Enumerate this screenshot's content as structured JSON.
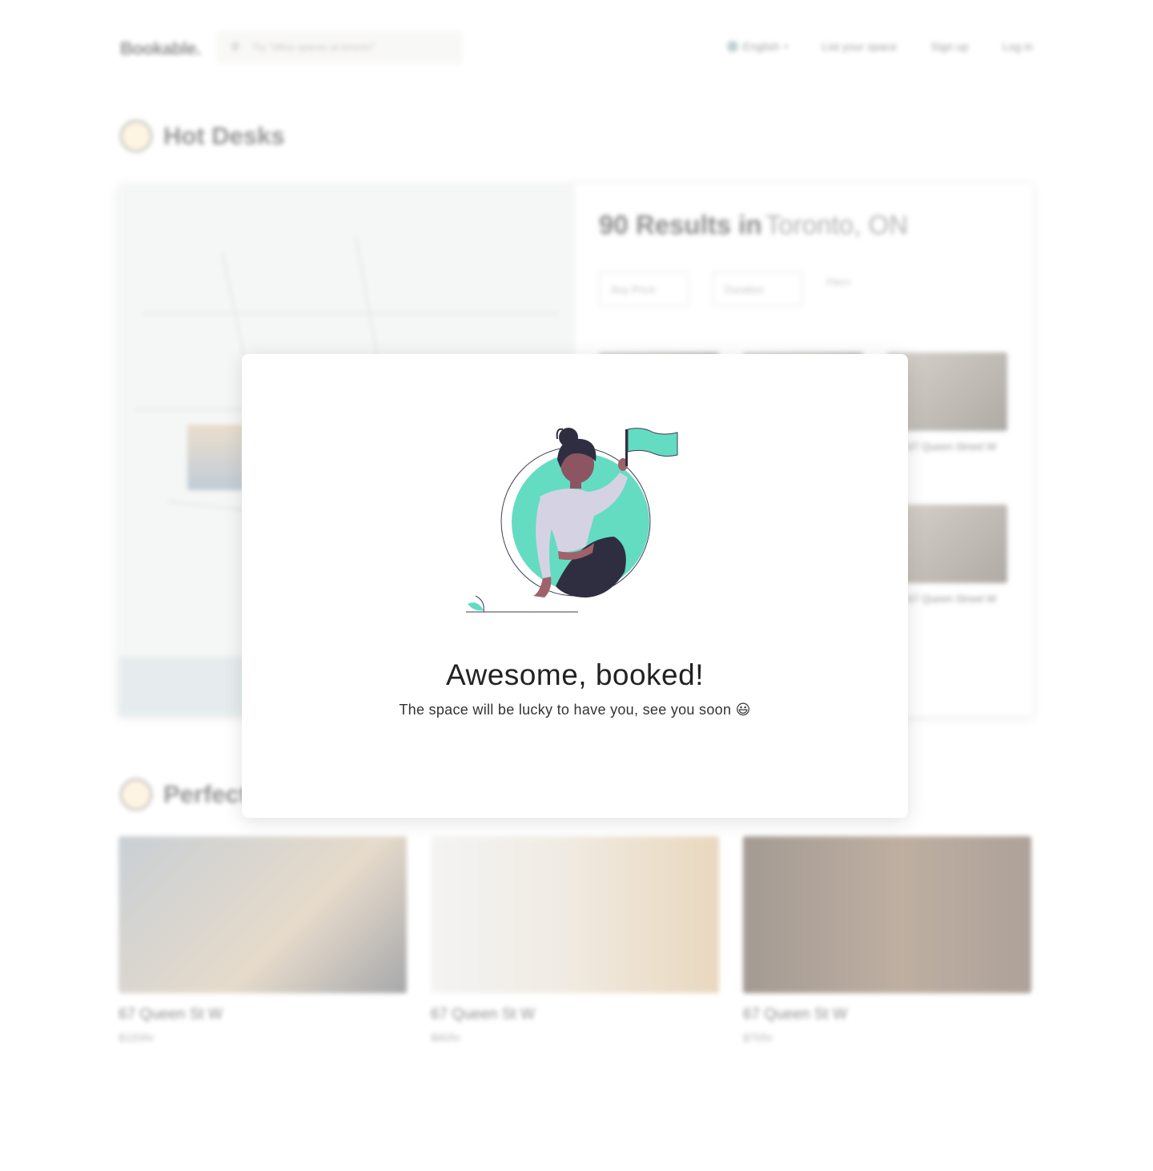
{
  "header": {
    "logo": "Bookable.",
    "search_placeholder": "Try \"office spaces at toronto\"",
    "language": "English",
    "list_space": "List your space",
    "sign_up": "Sign up",
    "log_in": "Log in"
  },
  "hot_desks": {
    "title": "Hot Desks",
    "results_count": "90 Results in",
    "results_location": "Toronto, ON",
    "filters": [
      "Any Price",
      "Duration"
    ],
    "more_filters": "Filters",
    "listings": [
      {
        "address": "67 Queen Street W"
      },
      {
        "address": "67 Queen Street W"
      }
    ]
  },
  "perfect_section": {
    "title": "Perfect",
    "cards": [
      {
        "address": "67 Queen St W",
        "price": "$120/hr"
      },
      {
        "address": "67 Queen St W",
        "price": "$90/hr"
      },
      {
        "address": "67 Queen St W",
        "price": "$75/hr"
      }
    ]
  },
  "modal": {
    "title": "Awesome, booked!",
    "subtitle": "The space will be lucky to have you, see you soon 😃",
    "accent_color": "#64dcc2"
  }
}
